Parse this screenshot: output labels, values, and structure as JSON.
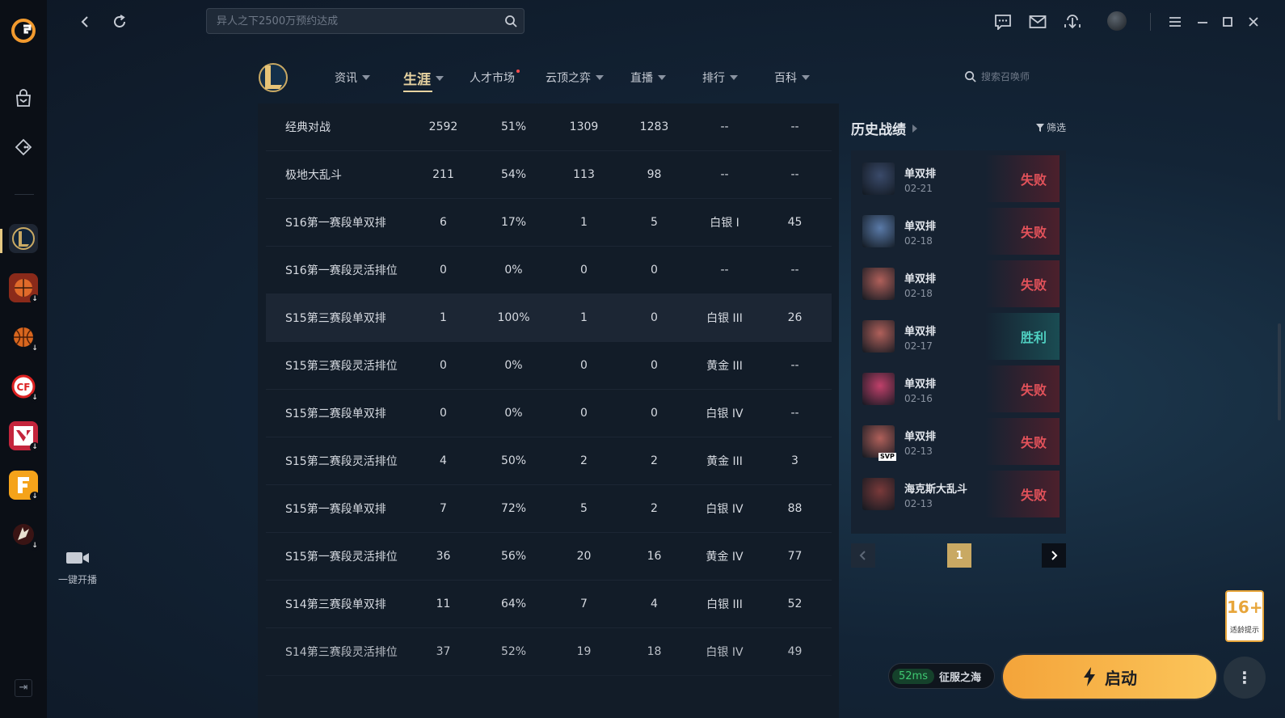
{
  "topbar": {
    "search_placeholder": "异人之下2500万预约达成"
  },
  "rail": {
    "live_label": "一键开播"
  },
  "lol_nav": {
    "items": [
      {
        "label": "资讯"
      },
      {
        "label": "生涯"
      },
      {
        "label": "人才市场"
      },
      {
        "label": "云顶之弈"
      },
      {
        "label": "直播"
      },
      {
        "label": "排行"
      },
      {
        "label": "百科"
      }
    ],
    "summoner_placeholder": "搜索召唤师"
  },
  "career_table": {
    "rows": [
      {
        "mode": "经典对战",
        "games": "2592",
        "winrate": "51%",
        "wins": "1309",
        "losses": "1283",
        "rank": "--",
        "points": "--"
      },
      {
        "mode": "极地大乱斗",
        "games": "211",
        "winrate": "54%",
        "wins": "113",
        "losses": "98",
        "rank": "--",
        "points": "--"
      },
      {
        "mode": "S16第一赛段单双排",
        "games": "6",
        "winrate": "17%",
        "wins": "1",
        "losses": "5",
        "rank": "白银 I",
        "points": "45"
      },
      {
        "mode": "S16第一赛段灵活排位",
        "games": "0",
        "winrate": "0%",
        "wins": "0",
        "losses": "0",
        "rank": "--",
        "points": "--"
      },
      {
        "mode": "S15第三赛段单双排",
        "games": "1",
        "winrate": "100%",
        "wins": "1",
        "losses": "0",
        "rank": "白银 III",
        "points": "26"
      },
      {
        "mode": "S15第三赛段灵活排位",
        "games": "0",
        "winrate": "0%",
        "wins": "0",
        "losses": "0",
        "rank": "黄金 III",
        "points": "--"
      },
      {
        "mode": "S15第二赛段单双排",
        "games": "0",
        "winrate": "0%",
        "wins": "0",
        "losses": "0",
        "rank": "白银 IV",
        "points": "--"
      },
      {
        "mode": "S15第二赛段灵活排位",
        "games": "4",
        "winrate": "50%",
        "wins": "2",
        "losses": "2",
        "rank": "黄金 III",
        "points": "3"
      },
      {
        "mode": "S15第一赛段单双排",
        "games": "7",
        "winrate": "72%",
        "wins": "5",
        "losses": "2",
        "rank": "白银 IV",
        "points": "88"
      },
      {
        "mode": "S15第一赛段灵活排位",
        "games": "36",
        "winrate": "56%",
        "wins": "20",
        "losses": "16",
        "rank": "黄金 IV",
        "points": "77"
      },
      {
        "mode": "S14第三赛段单双排",
        "games": "11",
        "winrate": "64%",
        "wins": "7",
        "losses": "4",
        "rank": "白银 III",
        "points": "52"
      },
      {
        "mode": "S14第三赛段灵活排位",
        "games": "37",
        "winrate": "52%",
        "wins": "19",
        "losses": "18",
        "rank": "白银 IV",
        "points": "49"
      }
    ]
  },
  "history": {
    "title": "历史战绩",
    "filter_label": "筛选",
    "matches": [
      {
        "mode": "单双排",
        "date": "02-21",
        "result": "失败",
        "outcome": "lose",
        "color": "#3a4a6a"
      },
      {
        "mode": "单双排",
        "date": "02-18",
        "result": "失败",
        "outcome": "lose",
        "color": "#5a7aa8"
      },
      {
        "mode": "单双排",
        "date": "02-18",
        "result": "失败",
        "outcome": "lose",
        "color": "#b0605a"
      },
      {
        "mode": "单双排",
        "date": "02-17",
        "result": "胜利",
        "outcome": "win",
        "color": "#b0605a"
      },
      {
        "mode": "单双排",
        "date": "02-16",
        "result": "失败",
        "outcome": "lose",
        "color": "#c0406a"
      },
      {
        "mode": "单双排",
        "date": "02-13",
        "result": "失败",
        "outcome": "lose",
        "color": "#b0605a",
        "badge": "SVP"
      },
      {
        "mode": "海克斯大乱斗",
        "date": "02-13",
        "result": "失败",
        "outcome": "lose",
        "color": "#7a3a3a"
      }
    ],
    "page": "1"
  },
  "bottom": {
    "age_rating": "16+",
    "age_note": "适龄提示",
    "ping": "52ms",
    "server": "征服之海",
    "launch_label": "启动"
  }
}
